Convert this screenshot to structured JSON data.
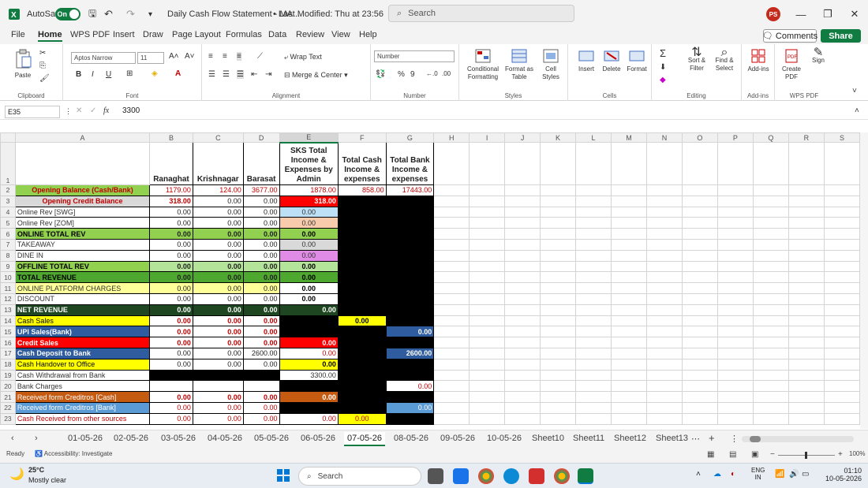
{
  "titlebar": {
    "autosave_label": "AutoSave",
    "autosave_state": "On",
    "doc_title": "Daily Cash Flow Statement - MA...",
    "last_modified": "• Last Modified: Thu at 23:56",
    "search_placeholder": "Search",
    "user_initials": "PS"
  },
  "menu": [
    "File",
    "Home",
    "WPS PDF",
    "Insert",
    "Draw",
    "Page Layout",
    "Formulas",
    "Data",
    "Review",
    "View",
    "Help"
  ],
  "active_menu": "Home",
  "comments_label": "Comments",
  "share_label": "Share",
  "ribbon": {
    "paste": "Paste",
    "clipboard": "Clipboard",
    "font_name": "Aptos Narrow",
    "font_size": "11",
    "font": "Font",
    "wrap_text": "Wrap Text",
    "merge_center": "Merge & Center",
    "alignment": "Alignment",
    "number_format": "Number",
    "number": "Number",
    "conditional_formatting": "Conditional Formatting",
    "format_as_table": "Format as Table",
    "cell_styles": "Cell Styles",
    "styles": "Styles",
    "insert": "Insert",
    "delete": "Delete",
    "format": "Format",
    "cells": "Cells",
    "sort_filter": "Sort & Filter",
    "find_select": "Find & Select",
    "editing": "Editing",
    "addins": "Add-ins",
    "addins_group": "Add-ins",
    "create_pdf": "Create PDF",
    "sign": "Sign",
    "wps_pdf": "WPS PDF",
    "bold": "B",
    "italic": "I",
    "underline": "U"
  },
  "formula_bar": {
    "name_box": "E35",
    "fx": "fx",
    "value": "3300"
  },
  "columns": [
    "A",
    "B",
    "C",
    "D",
    "E",
    "F",
    "G",
    "H",
    "I",
    "J",
    "K",
    "L",
    "M",
    "N",
    "O",
    "P",
    "Q",
    "R",
    "S"
  ],
  "header_row": {
    "b": "Ranaghat",
    "c": "Krishnagar",
    "d": "Barasat",
    "e": "SKS Total Income & Expenses by Admin",
    "f": "Total Cash Income & expenses",
    "g": "Total Bank Income & expenses"
  },
  "rows": [
    {
      "n": "2",
      "a": "Opening Balance (Cash/Bank)",
      "b": "1179.00",
      "c": "124.00",
      "d": "3677.00",
      "e": "1878.00",
      "f": "858.00",
      "g": "17443.00"
    },
    {
      "n": "3",
      "a": "Opening Credit Balance",
      "b": "318.00",
      "c": "0.00",
      "d": "0.00",
      "e": "318.00",
      "f": "",
      "g": ""
    },
    {
      "n": "4",
      "a": "Online Rev [SWG]",
      "b": "0.00",
      "c": "0.00",
      "d": "0.00",
      "e": "0.00",
      "f": "",
      "g": ""
    },
    {
      "n": "5",
      "a": "Online Rev [ZOM]",
      "b": "0.00",
      "c": "0.00",
      "d": "0.00",
      "e": "0.00",
      "f": "",
      "g": ""
    },
    {
      "n": "6",
      "a": "ONLINE TOTAL REV",
      "b": "0.00",
      "c": "0.00",
      "d": "0.00",
      "e": "0.00",
      "f": "",
      "g": ""
    },
    {
      "n": "7",
      "a": "TAKEAWAY",
      "b": "0.00",
      "c": "0.00",
      "d": "0.00",
      "e": "0.00",
      "f": "",
      "g": ""
    },
    {
      "n": "8",
      "a": "DINE IN",
      "b": "0.00",
      "c": "0.00",
      "d": "0.00",
      "e": "0.00",
      "f": "",
      "g": ""
    },
    {
      "n": "9",
      "a": "OFFLINE TOTAL REV",
      "b": "0.00",
      "c": "0.00",
      "d": "0.00",
      "e": "0.00",
      "f": "",
      "g": ""
    },
    {
      "n": "10",
      "a": "TOTAL REVENUE",
      "b": "0.00",
      "c": "0.00",
      "d": "0.00",
      "e": "0.00",
      "f": "",
      "g": ""
    },
    {
      "n": "11",
      "a": "ONLINE PLATFORM CHARGES",
      "b": "0.00",
      "c": "0.00",
      "d": "0.00",
      "e": "0.00",
      "f": "",
      "g": ""
    },
    {
      "n": "12",
      "a": "DISCOUNT",
      "b": "0.00",
      "c": "0.00",
      "d": "0.00",
      "e": "0.00",
      "f": "",
      "g": ""
    },
    {
      "n": "13",
      "a": "NET REVENUE",
      "b": "0.00",
      "c": "0.00",
      "d": "0.00",
      "e": "0.00",
      "f": "",
      "g": ""
    },
    {
      "n": "14",
      "a": "Cash Sales",
      "b": "0.00",
      "c": "0.00",
      "d": "0.00",
      "e": "",
      "f": "0.00",
      "g": ""
    },
    {
      "n": "15",
      "a": "UPI Sales(Bank)",
      "b": "0.00",
      "c": "0.00",
      "d": "0.00",
      "e": "",
      "f": "",
      "g": "0.00"
    },
    {
      "n": "16",
      "a": "Credit Sales",
      "b": "0.00",
      "c": "0.00",
      "d": "0.00",
      "e": "0.00",
      "f": "",
      "g": ""
    },
    {
      "n": "17",
      "a": "Cash Deposit to Bank",
      "b": "0.00",
      "c": "0.00",
      "d": "2600.00",
      "e": "0.00",
      "f": "",
      "g": "2600.00"
    },
    {
      "n": "18",
      "a": "Cash Handover to Office",
      "b": "0.00",
      "c": "0.00",
      "d": "0.00",
      "e": "0.00",
      "f": "",
      "g": ""
    },
    {
      "n": "19",
      "a": "Cash Withdrawal from Bank",
      "b": "",
      "c": "",
      "d": "",
      "e": "3300.00",
      "f": "",
      "g": ""
    },
    {
      "n": "20",
      "a": "Bank Charges",
      "b": "",
      "c": "",
      "d": "",
      "e": "",
      "f": "",
      "g": "0.00"
    },
    {
      "n": "21",
      "a": "Received form Creditros [Cash]",
      "b": "0.00",
      "c": "0.00",
      "d": "0.00",
      "e": "0.00",
      "f": "",
      "g": ""
    },
    {
      "n": "22",
      "a": "Received form Creditros [Bank]",
      "b": "0.00",
      "c": "0.00",
      "d": "0.00",
      "e": "",
      "f": "",
      "g": "0.00"
    },
    {
      "n": "23",
      "a": "Cash Received from other sources",
      "b": "0.00",
      "c": "0.00",
      "d": "0.00",
      "e": "0.00",
      "f": "0.00",
      "g": ""
    }
  ],
  "sheets": [
    "01-05-26",
    "02-05-26",
    "03-05-26",
    "04-05-26",
    "05-05-26",
    "06-05-26",
    "07-05-26",
    "08-05-26",
    "09-05-26",
    "10-05-26",
    "Sheet10",
    "Sheet11",
    "Sheet12",
    "Sheet13"
  ],
  "active_sheet": "07-05-26",
  "status": {
    "ready": "Ready",
    "accessibility": "Accessibility: Investigate",
    "zoom": "100%"
  },
  "taskbar": {
    "temp": "25°C",
    "weather": "Mostly clear",
    "search": "Search",
    "lang1": "ENG",
    "lang2": "IN",
    "time": "01:10",
    "date": "10-05-2026"
  }
}
